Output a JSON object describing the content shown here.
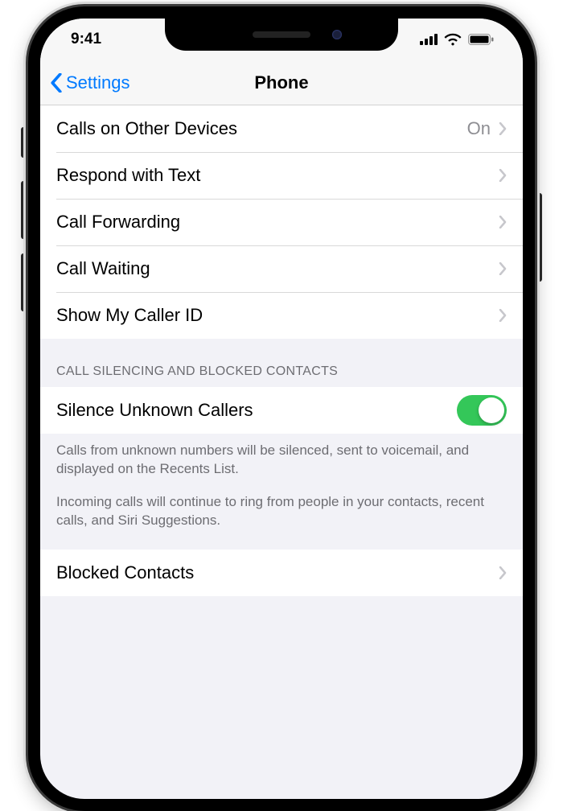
{
  "status": {
    "time": "9:41"
  },
  "nav": {
    "back_label": "Settings",
    "title": "Phone"
  },
  "calls_group": {
    "calls_other_devices": {
      "label": "Calls on Other Devices",
      "value": "On"
    },
    "respond_text": {
      "label": "Respond with Text"
    },
    "call_forwarding": {
      "label": "Call Forwarding"
    },
    "call_waiting": {
      "label": "Call Waiting"
    },
    "show_caller_id": {
      "label": "Show My Caller ID"
    }
  },
  "silencing": {
    "header": "Call Silencing and Blocked Contacts",
    "silence_unknown": {
      "label": "Silence Unknown Callers",
      "on": true
    },
    "footer_1": "Calls from unknown numbers will be silenced, sent to voicemail, and displayed on the Recents List.",
    "footer_2": "Incoming calls will continue to ring from people in your contacts, recent calls, and Siri Suggestions."
  },
  "blocked": {
    "label": "Blocked Contacts"
  }
}
